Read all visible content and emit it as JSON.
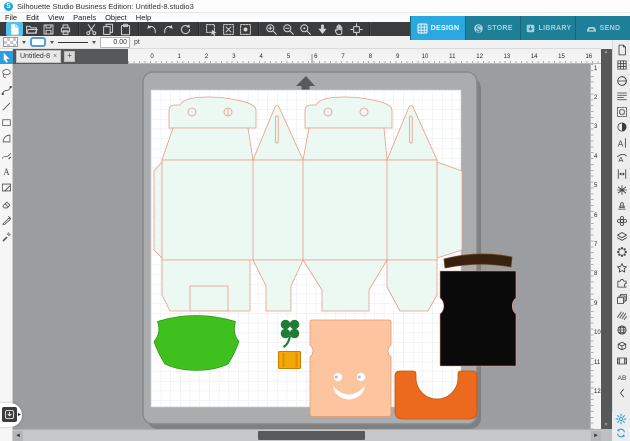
{
  "window": {
    "title": "Silhouette Studio Business Edition: Untitled-8.studio3",
    "logo_letter": "S"
  },
  "menu": {
    "items": [
      "File",
      "Edit",
      "View",
      "Panels",
      "Object",
      "Help"
    ]
  },
  "nav_tabs": [
    {
      "label": "DESIGN",
      "icon": "tab-design",
      "active": true
    },
    {
      "label": "STORE",
      "icon": "tab-store",
      "active": false
    },
    {
      "label": "LIBRARY",
      "icon": "tab-library",
      "active": false
    },
    {
      "label": "SEND",
      "icon": "tab-send",
      "active": false
    }
  ],
  "toolbar_groups": [
    [
      "new-document",
      "open",
      "save",
      "print"
    ],
    [
      "cut",
      "copy",
      "paste"
    ],
    [
      "undo",
      "redo",
      "rotate"
    ],
    [
      "selection-box",
      "deselect",
      "selection-modified"
    ],
    [
      "zoom-in",
      "zoom-out",
      "zoom-selection",
      "drag-zoom",
      "pan",
      "fit-to-window"
    ]
  ],
  "style_bar": {
    "line_weight": "0.00",
    "unit": "pt"
  },
  "doc_tabs": {
    "active_tab": "Untitled-8",
    "close_label": "×",
    "new_tab_label": "+"
  },
  "left_tools": [
    "select",
    "lasso-select",
    "edit-points",
    "line",
    "rectangle",
    "arc-polygon",
    "freehand",
    "text",
    "sketch",
    "eraser",
    "knife",
    "eyedropper"
  ],
  "right_panels": [
    "page-setup",
    "pixel-grid",
    "pinwheel",
    "line-styles",
    "trace-frame",
    "fill-contrast",
    "character",
    "text-to-path",
    "spacing",
    "weld",
    "stamp",
    "flower-offset",
    "layers",
    "offset-points",
    "star",
    "puzzle",
    "replicate",
    "hatch-shadow",
    "globe",
    "box-3d",
    "film",
    "ab-preview",
    "collapse"
  ],
  "right_footer": [
    "preferences",
    "sync"
  ],
  "canvas": {
    "ruler_top": [
      "0",
      "1",
      "2",
      "3",
      "4",
      "5",
      "6",
      "7",
      "8",
      "9",
      "10",
      "11",
      "12",
      "13",
      "14",
      "15",
      "16"
    ],
    "ruler_right": [
      "1",
      "2",
      "3",
      "4",
      "5",
      "6",
      "7",
      "8",
      "9",
      "10",
      "11",
      "12"
    ],
    "objects": {
      "box_template": {
        "label": "gable box die-cut template",
        "fill": "#ecf9f2",
        "cut_line": "#e89b8d"
      },
      "green_brim": {
        "label": "green hat brim",
        "fill": "#3fc01e",
        "stroke": "#2c9812"
      },
      "shamrock": {
        "label": "shamrock",
        "fill": "#1f7d34"
      },
      "buckle": {
        "label": "gold buckle",
        "fill": "#f3a808",
        "stroke": "#c97e00"
      },
      "face": {
        "label": "leprechaun face",
        "fill": "#fcc5a0",
        "stroke": "#e5996d"
      },
      "hat_band": {
        "label": "brown hat band",
        "fill": "#38220f"
      },
      "vest": {
        "label": "black hat",
        "fill": "#0a0a0a"
      },
      "beard": {
        "label": "orange beard",
        "fill": "#eb6a1d",
        "stroke": "#c75208"
      }
    }
  },
  "colors": {
    "accent_blue": "#2aa9e0",
    "teal": "#1e7f99",
    "toolbar_dark": "#3b3c3e",
    "canvas_gray": "#9b9da0"
  }
}
